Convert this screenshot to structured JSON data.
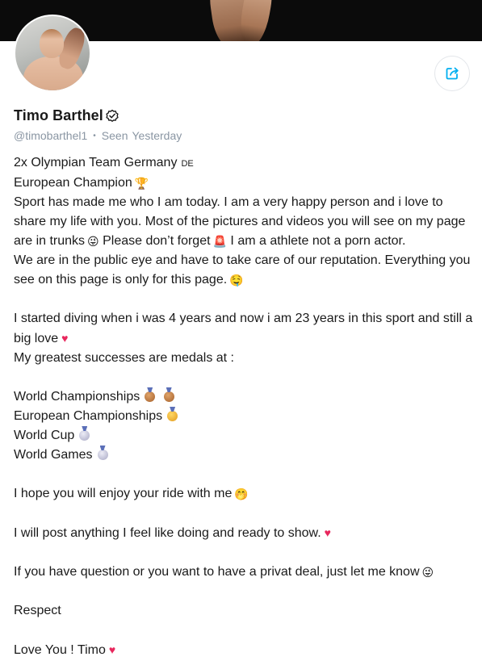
{
  "profile": {
    "name": "Timo Barthel",
    "handle": "@timobarthel1",
    "seen_label": "Seen",
    "seen_value": "Yesterday"
  },
  "icons": {
    "verified": "verified-badge-icon",
    "share": "share-icon",
    "trophy": "trophy-icon",
    "heart": "heart-icon",
    "medal": "medal-icon",
    "smile": "smile-face-icon"
  },
  "colors": {
    "accent": "#00aff0",
    "muted": "#8a96a3",
    "heart": "#e8275d"
  },
  "bio": {
    "line1": "2x Olympian Team Germany",
    "line1_flag": "DE",
    "line2": "European Champion",
    "line3a": "Sport has made me who I am today. I am a very happy person and i love to share my life with you. Most of the pictures and videos you will see on my page are in trunks",
    "line3b": "Please don’t forget",
    "line3c": "I am a athlete not a porn actor.",
    "line4": "We are in the public eye and have to take care of our reputation. Everything you see on this page is only for this page.",
    "line5": "I started diving when i was 4 years and now i am 23 years in this sport and still a big love",
    "line6": "My greatest successes are medals at :",
    "medal1": "World Championships",
    "medal2": "European Championships",
    "medal3": "World Cup",
    "medal4": "World Games",
    "line7": "I hope you will enjoy your ride with me",
    "line8": "I will post anything I feel like doing and ready to show.",
    "line9": "If you have question or you want to have a privat deal, just let me know",
    "line10": "Respect",
    "line11": "Love You ! Timo"
  }
}
